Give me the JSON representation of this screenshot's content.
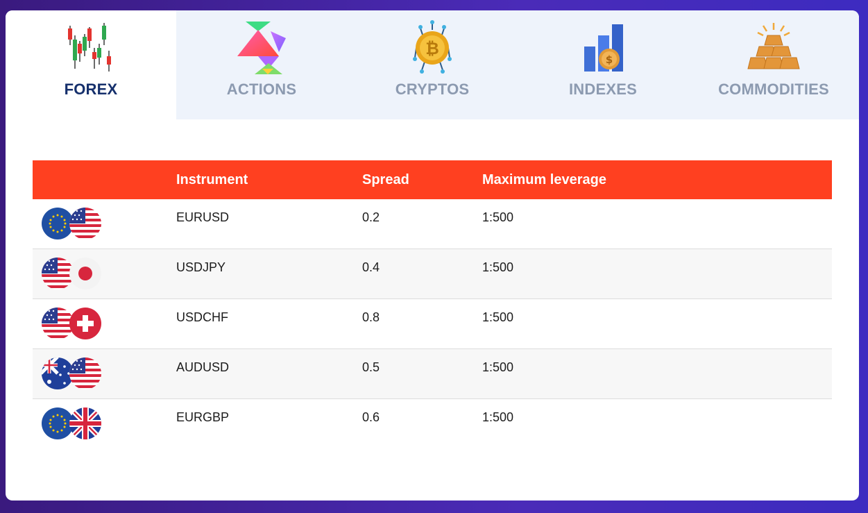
{
  "tabs": [
    {
      "id": "forex",
      "label": "FOREX",
      "icon": "candlestick-chart-icon",
      "active": true
    },
    {
      "id": "actions",
      "label": "ACTIONS",
      "icon": "triangles-icon",
      "active": false
    },
    {
      "id": "cryptos",
      "label": "CRYPTOS",
      "icon": "bitcoin-icon",
      "active": false
    },
    {
      "id": "indexes",
      "label": "INDEXES",
      "icon": "bar-chart-coin-icon",
      "active": false
    },
    {
      "id": "commodities",
      "label": "COMMODITIES",
      "icon": "gold-bars-icon",
      "active": false
    }
  ],
  "table": {
    "headers": {
      "flag": "",
      "instrument": "Instrument",
      "spread": "Spread",
      "leverage": "Maximum leverage"
    },
    "rows": [
      {
        "flags": [
          "eu-flag",
          "us-flag"
        ],
        "instrument": "EURUSD",
        "spread": "0.2",
        "leverage": "1:500"
      },
      {
        "flags": [
          "us-flag",
          "jp-flag"
        ],
        "instrument": "USDJPY",
        "spread": "0.4",
        "leverage": "1:500"
      },
      {
        "flags": [
          "us-flag",
          "ch-flag"
        ],
        "instrument": "USDCHF",
        "spread": "0.8",
        "leverage": "1:500"
      },
      {
        "flags": [
          "au-flag",
          "us-flag"
        ],
        "instrument": "AUDUSD",
        "spread": "0.5",
        "leverage": "1:500"
      },
      {
        "flags": [
          "eu-flag",
          "gb-flag"
        ],
        "instrument": "EURGBP",
        "spread": "0.6",
        "leverage": "1:500"
      }
    ]
  },
  "colors": {
    "header_bg": "#ff4020",
    "active_tab_text": "#16306c",
    "inactive_tab_text": "#8c9ab0",
    "page_bg": "#4a2bb8"
  }
}
